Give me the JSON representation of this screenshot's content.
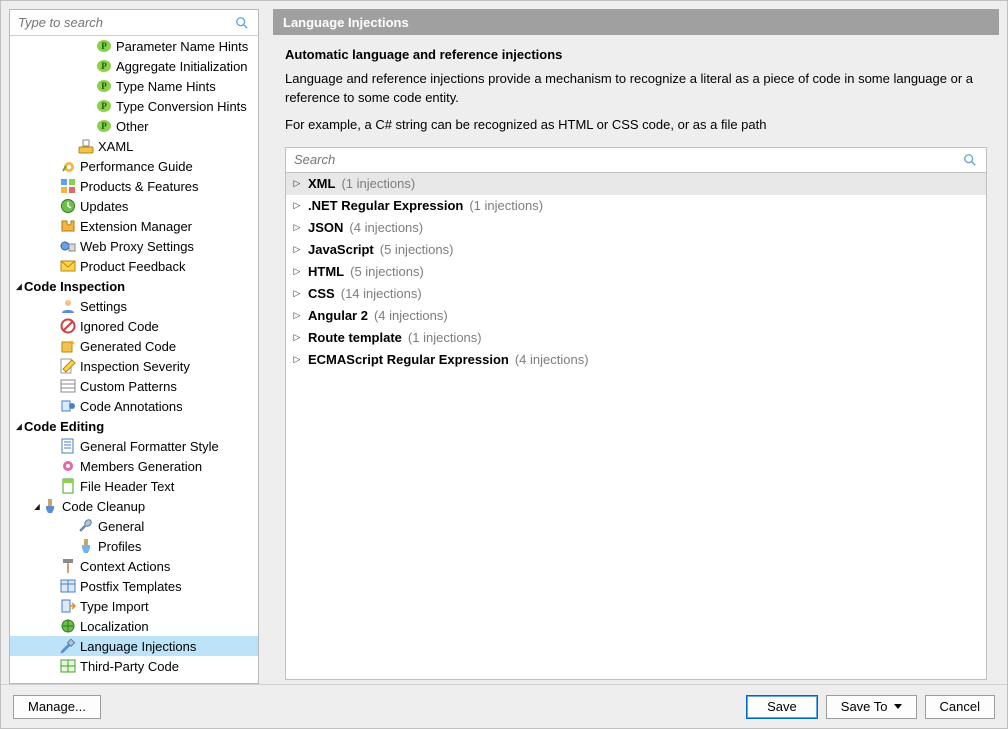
{
  "sidebar": {
    "search_placeholder": "Type to search",
    "items": [
      {
        "id": "param-hints",
        "label": "Parameter Name Hints",
        "depth": 4,
        "icon": "pill-p"
      },
      {
        "id": "agg-init",
        "label": "Aggregate Initialization",
        "depth": 4,
        "icon": "pill-p"
      },
      {
        "id": "type-name-hints",
        "label": "Type Name Hints",
        "depth": 4,
        "icon": "pill-p"
      },
      {
        "id": "type-conv-hints",
        "label": "Type Conversion Hints",
        "depth": 4,
        "icon": "pill-p"
      },
      {
        "id": "other-hints",
        "label": "Other",
        "depth": 4,
        "icon": "pill-p"
      },
      {
        "id": "xaml",
        "label": "XAML",
        "depth": 3,
        "icon": "xaml"
      },
      {
        "id": "perf-guide",
        "label": "Performance Guide",
        "depth": 2,
        "icon": "snail"
      },
      {
        "id": "products-features",
        "label": "Products & Features",
        "depth": 2,
        "icon": "blocks"
      },
      {
        "id": "updates",
        "label": "Updates",
        "depth": 2,
        "icon": "clock"
      },
      {
        "id": "ext-manager",
        "label": "Extension Manager",
        "depth": 2,
        "icon": "puzzle"
      },
      {
        "id": "web-proxy",
        "label": "Web Proxy Settings",
        "depth": 2,
        "icon": "globe"
      },
      {
        "id": "feedback",
        "label": "Product Feedback",
        "depth": 2,
        "icon": "envelope"
      },
      {
        "id": "code-inspection",
        "label": "Code Inspection",
        "depth": 0,
        "icon": "",
        "header": true,
        "arrow": "down"
      },
      {
        "id": "ci-settings",
        "label": "Settings",
        "depth": 2,
        "icon": "person"
      },
      {
        "id": "ignored-code",
        "label": "Ignored Code",
        "depth": 2,
        "icon": "hand-no"
      },
      {
        "id": "generated-code",
        "label": "Generated Code",
        "depth": 2,
        "icon": "box-spark"
      },
      {
        "id": "insp-severity",
        "label": "Inspection Severity",
        "depth": 2,
        "icon": "pencil-yel"
      },
      {
        "id": "custom-patterns",
        "label": "Custom Patterns",
        "depth": 2,
        "icon": "grid"
      },
      {
        "id": "code-annotations",
        "label": "Code Annotations",
        "depth": 2,
        "icon": "tag-blue"
      },
      {
        "id": "code-editing",
        "label": "Code Editing",
        "depth": 0,
        "icon": "",
        "header": true,
        "arrow": "down"
      },
      {
        "id": "gen-formatter",
        "label": "General Formatter Style",
        "depth": 2,
        "icon": "doc-lines"
      },
      {
        "id": "members-gen",
        "label": "Members Generation",
        "depth": 2,
        "icon": "gear-pink"
      },
      {
        "id": "file-header",
        "label": "File Header Text",
        "depth": 2,
        "icon": "doc-green"
      },
      {
        "id": "code-cleanup",
        "label": "Code Cleanup",
        "depth": 1,
        "icon": "brush",
        "arrow": "down"
      },
      {
        "id": "cc-general",
        "label": "General",
        "depth": 3,
        "icon": "wrench"
      },
      {
        "id": "cc-profiles",
        "label": "Profiles",
        "depth": 3,
        "icon": "brush2"
      },
      {
        "id": "context-actions",
        "label": "Context Actions",
        "depth": 2,
        "icon": "hammer"
      },
      {
        "id": "postfix-templates",
        "label": "Postfix Templates",
        "depth": 2,
        "icon": "grid-blue"
      },
      {
        "id": "type-import",
        "label": "Type Import",
        "depth": 2,
        "icon": "import"
      },
      {
        "id": "localization",
        "label": "Localization",
        "depth": 2,
        "icon": "globe2"
      },
      {
        "id": "language-inj",
        "label": "Language Injections",
        "depth": 2,
        "icon": "syringe",
        "selected": true
      },
      {
        "id": "third-party",
        "label": "Third-Party Code",
        "depth": 2,
        "icon": "grid-green"
      }
    ]
  },
  "panel": {
    "title": "Language Injections",
    "subtitle": "Automatic language and reference injections",
    "desc": "Language and reference injections provide a mechanism to recognize a literal as a piece of code in some language or a reference to some code entity.",
    "example": "For example, a C# string can be recognized as HTML or CSS code, or as a file path",
    "search_placeholder": "Search",
    "injections": [
      {
        "name": "XML",
        "count_label": "(1 injections)",
        "selected": true
      },
      {
        "name": ".NET Regular Expression",
        "count_label": "(1 injections)"
      },
      {
        "name": "JSON",
        "count_label": "(4 injections)"
      },
      {
        "name": "JavaScript",
        "count_label": "(5 injections)"
      },
      {
        "name": "HTML",
        "count_label": "(5 injections)"
      },
      {
        "name": "CSS",
        "count_label": "(14 injections)"
      },
      {
        "name": "Angular 2",
        "count_label": "(4 injections)"
      },
      {
        "name": "Route template",
        "count_label": "(1 injections)"
      },
      {
        "name": "ECMAScript Regular Expression",
        "count_label": "(4 injections)"
      }
    ]
  },
  "buttons": {
    "manage": "Manage...",
    "save": "Save",
    "save_to": "Save To",
    "cancel": "Cancel"
  }
}
